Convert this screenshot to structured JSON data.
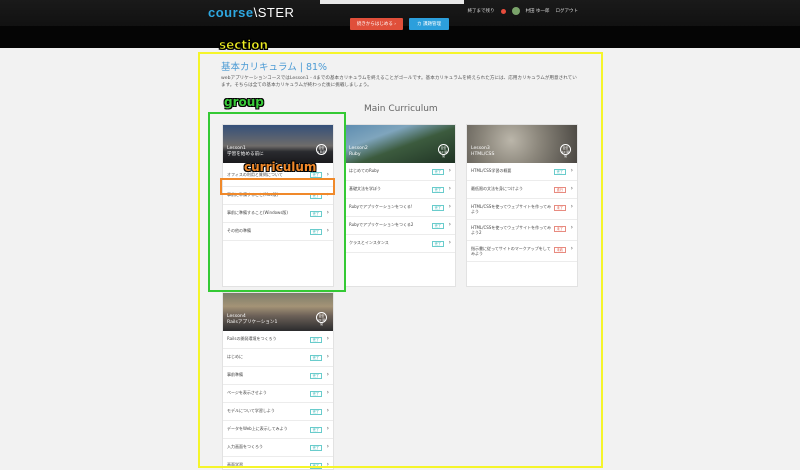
{
  "header": {
    "logo_part1": "course",
    "logo_part2": "\\STER",
    "user_link1": "終了まで残り",
    "user_name": "村田 ゆ一郎",
    "user_link2": "ログアウト",
    "start_button": "続きからはじめる ›",
    "change_button": "カ 課題管理"
  },
  "annotations": {
    "section": "section",
    "group": "group",
    "curriculum": "curriculum"
  },
  "section": {
    "title": "基本カリキュラム | 81%",
    "description": "webアプリケーションコースではLesson1 - 4までの基本カリキュラムを終えることがゴールです。基本カリキュラムを終えられた方には、応用カリキュラムが用意されています。そちらは全ての基本カリキュラムが終わった後に挑戦しましょう。",
    "heading": "Main Curriculum"
  },
  "cards": [
    {
      "lesson": "Lesson1",
      "title": "学習を始める前に",
      "time_top": "目安",
      "time_bottom": "1 時間",
      "rows": [
        {
          "text": "オフィスの利用と質問について",
          "status": "完了"
        },
        {
          "text": "事前に準備すること(Mac版)",
          "status": "完了"
        },
        {
          "text": "事前に準備すること(Windows版)",
          "status": "完了"
        },
        {
          "text": "その他の準備",
          "status": "完了"
        }
      ]
    },
    {
      "lesson": "Lesson2",
      "title": "Ruby",
      "time_top": "目安",
      "time_bottom": "10 時間",
      "rows": [
        {
          "text": "はじめてのRuby",
          "status": "完了"
        },
        {
          "text": "基礎文法を学ぼう",
          "status": "完了"
        },
        {
          "text": "Rubyでアプリケーションをつくる!",
          "status": "完了"
        },
        {
          "text": "Rubyでアプリケーションをつくる2",
          "status": "完了"
        },
        {
          "text": "クラスとインスタンス",
          "status": "完了"
        }
      ]
    },
    {
      "lesson": "Lesson3",
      "title": "HTML/CSS",
      "time_top": "目安",
      "time_bottom": "10 時間",
      "rows": [
        {
          "text": "HTML/CSS学習の概要",
          "status": "完了"
        },
        {
          "text": "最低限の文法を身につけよう",
          "status": "進行"
        },
        {
          "text": "HTML/CSSを使ってウェブサイトを作ってみよう",
          "status": "未了"
        },
        {
          "text": "HTML/CSSを使ってウェブサイトを作ってみよう2",
          "status": "未了"
        },
        {
          "text": "指示書に従ってサイトのマークアップをしてみよう",
          "status": "未着"
        }
      ]
    },
    {
      "lesson": "Lesson4",
      "title": "Railsアプリケーション1",
      "time_top": "目安",
      "time_bottom": "20 時間",
      "rows": [
        {
          "text": "Railsの開発環境をつくろう",
          "status": "完了"
        },
        {
          "text": "はじめに",
          "status": "完了"
        },
        {
          "text": "事前準備",
          "status": "完了"
        },
        {
          "text": "ページを表示させよう",
          "status": "完了"
        },
        {
          "text": "モデルについて学習しよう",
          "status": "完了"
        },
        {
          "text": "データをWeb上に表示してみよう",
          "status": "完了"
        },
        {
          "text": "入力画面をつくろう",
          "status": "完了"
        },
        {
          "text": "画面学習",
          "status": "完了"
        }
      ]
    }
  ]
}
